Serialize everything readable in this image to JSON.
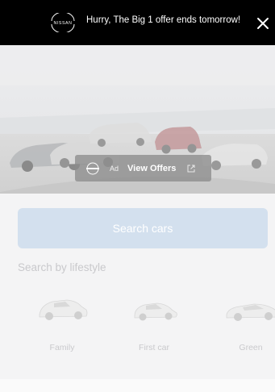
{
  "banner": {
    "brand_logo_text": "NISSAN",
    "message": "Hurry, The Big 1 offer ends tomorrow!",
    "close_icon": "close-icon"
  },
  "hero": {
    "image": "cars-on-beach-photo",
    "ad_overlay": {
      "ad_label": "Ad",
      "cta": "View Offers",
      "icons": [
        "nissan-logo-icon",
        "external-link-icon"
      ]
    }
  },
  "search": {
    "button_label": "Search cars"
  },
  "lifestyle": {
    "title": "Search by lifestyle",
    "categories": [
      {
        "label": "Family",
        "icon": "suv-car-icon"
      },
      {
        "label": "First car",
        "icon": "hatchback-car-icon"
      },
      {
        "label": "Green",
        "icon": "electric-car-icon"
      }
    ]
  },
  "colors": {
    "banner_bg": "#000000",
    "search_button_bg": "#d3e0ee",
    "muted_text": "#c9c9cc",
    "page_bg": "#f4f4f5"
  }
}
